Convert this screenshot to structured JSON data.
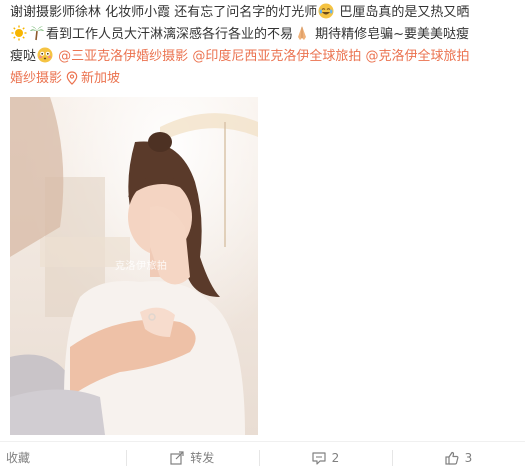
{
  "post": {
    "line1_a": "谢谢摄影师徐林 化妆师小霞 还有忘了问名字的灯光师",
    "line1_b": " 巴厘岛真的是又热又晒",
    "line2": "看到工作人员大汗淋漓深感各行各业的不易",
    "line2_b": " 期待精修皂骗~要美美哒瘦",
    "line3_a": "瘦哒",
    "mention1": "@三亚克洛伊婚纱摄影",
    "mention2": "@印度尼西亚克洛伊全球旅拍",
    "mention3": "@克洛伊全球旅拍",
    "line4_a": "婚纱摄影",
    "location": "新加坡"
  },
  "photo": {
    "watermark": "克洛伊旅拍"
  },
  "icons": {
    "emoji1": "laugh-cry-emoji",
    "emoji2": "sun-emoji",
    "emoji3": "palm-tree-emoji",
    "emoji4": "praying-hands-emoji",
    "emoji5": "flushed-face-emoji",
    "location": "location-pin-icon",
    "repost": "repost-icon",
    "comment": "comment-icon",
    "like": "thumbs-up-icon"
  },
  "actions": {
    "favorite_label": "收藏",
    "repost_label": "转发",
    "comment_count": "2",
    "like_count": "3"
  },
  "colors": {
    "mention": "#eb7350",
    "text": "#333333",
    "muted": "#808080"
  }
}
